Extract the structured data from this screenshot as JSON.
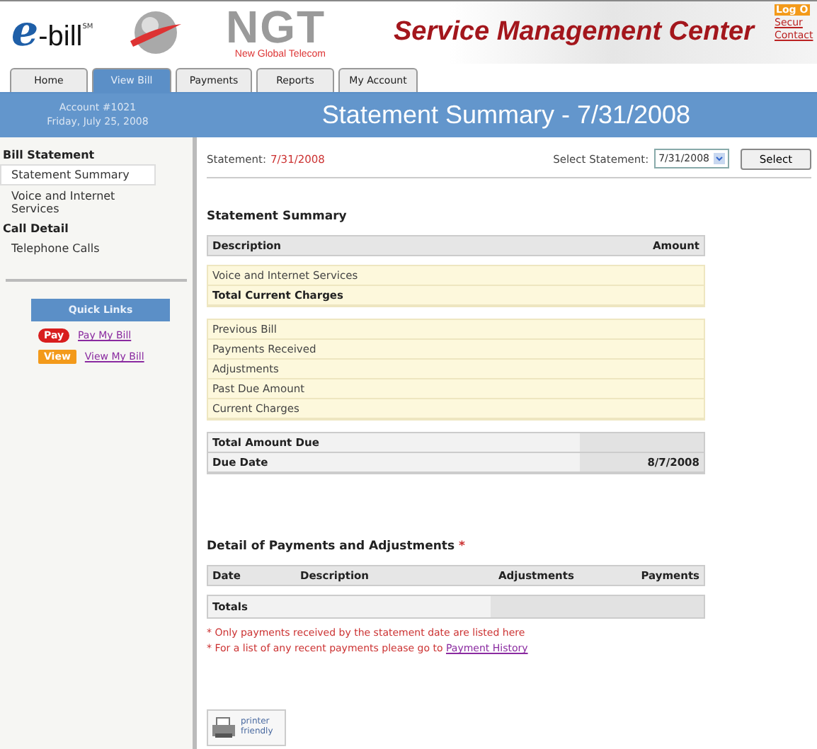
{
  "header": {
    "logo_e": "e",
    "logo_bill": "-bill",
    "logo_mark": "SM",
    "brand": "NGT",
    "brand_sub": "New Global Telecom",
    "title": "Service Management Center",
    "top_links": [
      {
        "label": "Log O",
        "kind": "badge"
      },
      {
        "label": "Secur",
        "kind": "link"
      },
      {
        "label": "Contact",
        "kind": "link"
      }
    ]
  },
  "tabs": [
    {
      "label": "Home",
      "selected": false
    },
    {
      "label": "View Bill",
      "selected": true
    },
    {
      "label": "Payments",
      "selected": false
    },
    {
      "label": "Reports",
      "selected": false
    },
    {
      "label": "My Account",
      "selected": false
    }
  ],
  "banner": {
    "account": "Account #1021",
    "date": "Friday, July 25, 2008",
    "title": "Statement Summary - 7/31/2008"
  },
  "sidebar": {
    "sections": [
      {
        "heading": "Bill Statement",
        "items": [
          {
            "label": "Statement Summary",
            "selected": true
          },
          {
            "label": "Voice and Internet Services",
            "selected": false
          }
        ]
      },
      {
        "heading": "Call Detail",
        "items": [
          {
            "label": "Telephone Calls",
            "selected": false
          }
        ]
      }
    ],
    "quick_links": {
      "title": "Quick Links",
      "items": [
        {
          "badge": "Pay",
          "label": "Pay My Bill",
          "color": "#d81e1e"
        },
        {
          "badge": "View",
          "label": "View My Bill",
          "color": "#f39a1a"
        }
      ]
    }
  },
  "statement": {
    "label": "Statement:",
    "date": "7/31/2008",
    "select_label": "Select Statement:",
    "select_value": "7/31/2008",
    "button": "Select"
  },
  "summary": {
    "title": "Statement Summary",
    "columns": [
      "Description",
      "Amount"
    ],
    "groups": [
      {
        "kind": "charges",
        "rows": [
          {
            "label": "Voice and Internet Services",
            "bold": false
          },
          {
            "label": "Total Current Charges",
            "bold": true
          }
        ]
      },
      {
        "kind": "charges",
        "rows": [
          {
            "label": "Previous Bill",
            "bold": false
          },
          {
            "label": "Payments Received",
            "bold": false
          },
          {
            "label": "Adjustments",
            "bold": false
          },
          {
            "label": "Past Due Amount",
            "bold": false
          },
          {
            "label": "Current Charges",
            "bold": false
          }
        ]
      },
      {
        "kind": "totals",
        "rows": [
          {
            "label": "Total Amount Due",
            "bold": true
          },
          {
            "label": "Due Date",
            "bold": true,
            "value": "8/7/2008"
          }
        ]
      }
    ]
  },
  "detail": {
    "title": "Detail of Payments and Adjustments",
    "marker": "*",
    "columns": [
      "Date",
      "Description",
      "Adjustments",
      "Payments"
    ],
    "totals": "Totals",
    "notes": [
      {
        "text": "* Only payments received by the statement date are listed here"
      },
      {
        "text": "* For a list of any recent payments please go to ",
        "link": "Payment History"
      }
    ]
  },
  "printer": {
    "line1": "printer",
    "line2": "friendly"
  }
}
